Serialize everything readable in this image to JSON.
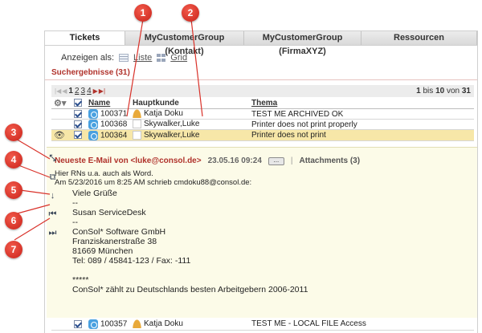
{
  "tabs": [
    {
      "label": "Tickets",
      "active": true
    },
    {
      "label": "MyCustomerGroup (Kontakt)",
      "active": false
    },
    {
      "label": "MyCustomerGroup (FirmaXYZ)",
      "active": false
    },
    {
      "label": "Ressourcen",
      "active": false
    }
  ],
  "view": {
    "label": "Anzeigen als:",
    "list": "Liste",
    "grid": "Grid"
  },
  "results": {
    "label": "Suchergebnisse (31)"
  },
  "pager": {
    "nav_first": "|◀",
    "nav_prev": "◀",
    "pages": [
      "1",
      "2",
      "3",
      "4"
    ],
    "nav_next": "▶",
    "nav_last": "▶|",
    "from": "1",
    "bis": "bis",
    "to": "10",
    "von": "von",
    "total": "31"
  },
  "table": {
    "headers": {
      "name": "Name",
      "hauptkunde": "Hauptkunde",
      "thema": "Thema"
    },
    "rows": [
      {
        "name": "100371",
        "customer": "Katja Doku",
        "topic": "TEST ME ARCHIVED OK",
        "selected": false
      },
      {
        "name": "100368",
        "customer": "Skywalker,Luke",
        "topic": "Printer does not print properly",
        "selected": false
      },
      {
        "name": "100364",
        "customer": "Skywalker,Luke",
        "topic": "Printer does not print",
        "selected": true
      }
    ],
    "bottom_row": {
      "name": "100357",
      "customer": "Katja Doku",
      "topic": "TEST ME - LOCAL FILE Access"
    }
  },
  "email": {
    "header": "Neueste E-Mail von <luke@consol.de>",
    "date": "23.05.16 09:24",
    "more": "...",
    "sep": "|",
    "attachments": "Attachments (3)",
    "body_line1": "Hier RNs u.a. auch als Word.",
    "body_line2": "Am 5/23/2016 um 8:25 AM schrieb cmdoku88@consol.de:",
    "quote": "Viele Grüße\n--\nSusan ServiceDesk\n--\nConSol* Software GmbH\nFranziskanerstraße 38\n81669 München\nTel: 089 / 45841-123 / Fax: -111\n\n*****\nConSol* zählt zu Deutschlands besten Arbeitgebern 2006-2011"
  },
  "callouts": [
    "1",
    "2",
    "3",
    "4",
    "5",
    "6",
    "7"
  ],
  "icons": {
    "expand": "expand-icon",
    "popout": "open-window-icon",
    "down": "arrow-down-icon",
    "first": "skip-first-icon",
    "last": "skip-last-icon"
  },
  "colors": {
    "accent_red": "#b0322b",
    "selected_row": "#f7e7a8",
    "preview_bg": "#fcfbe8",
    "marker": "#d9322a"
  }
}
